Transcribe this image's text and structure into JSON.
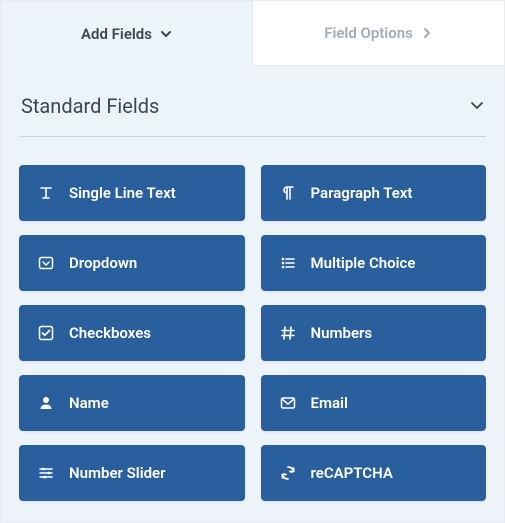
{
  "tabs": {
    "add_fields": "Add Fields",
    "field_options": "Field Options"
  },
  "section": {
    "title": "Standard Fields"
  },
  "fields": [
    {
      "icon": "text-input-icon",
      "label": "Single Line Text"
    },
    {
      "icon": "paragraph-icon",
      "label": "Paragraph Text"
    },
    {
      "icon": "dropdown-icon",
      "label": "Dropdown"
    },
    {
      "icon": "list-icon",
      "label": "Multiple Choice"
    },
    {
      "icon": "checkbox-icon",
      "label": "Checkboxes"
    },
    {
      "icon": "hash-icon",
      "label": "Numbers"
    },
    {
      "icon": "user-icon",
      "label": "Name"
    },
    {
      "icon": "envelope-icon",
      "label": "Email"
    },
    {
      "icon": "sliders-icon",
      "label": "Number Slider"
    },
    {
      "icon": "recaptcha-icon",
      "label": "reCAPTCHA"
    }
  ]
}
